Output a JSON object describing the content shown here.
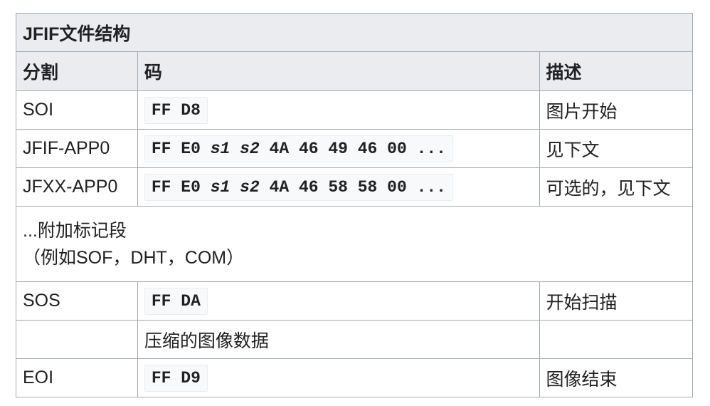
{
  "table": {
    "caption": "JFIF文件结构",
    "headers": [
      "分割",
      "码",
      "描述"
    ],
    "rows": [
      {
        "segment": "SOI",
        "code_parts": [
          "FF D8"
        ],
        "description": "图片开始"
      },
      {
        "segment": "JFIF-APP0",
        "code_parts": [
          "FF E0 ",
          "s1",
          " ",
          "s2",
          " 4A 46 49 46 00 ..."
        ],
        "description": "见下文"
      },
      {
        "segment": "JFXX-APP0",
        "code_parts": [
          "FF E0 ",
          "s1",
          " ",
          "s2",
          " 4A 46 58 58 00 ..."
        ],
        "description": "可选的，见下文"
      },
      {
        "note_line1": "...附加标记段",
        "note_line2": "（例如SOF，DHT，COM）"
      },
      {
        "segment": "SOS",
        "code_parts": [
          "FF DA"
        ],
        "description": "开始扫描"
      },
      {
        "segment": "",
        "code_text": "压缩的图像数据",
        "description": ""
      },
      {
        "segment": "EOI",
        "code_parts": [
          "FF D9"
        ],
        "description": "图像结束"
      }
    ]
  }
}
